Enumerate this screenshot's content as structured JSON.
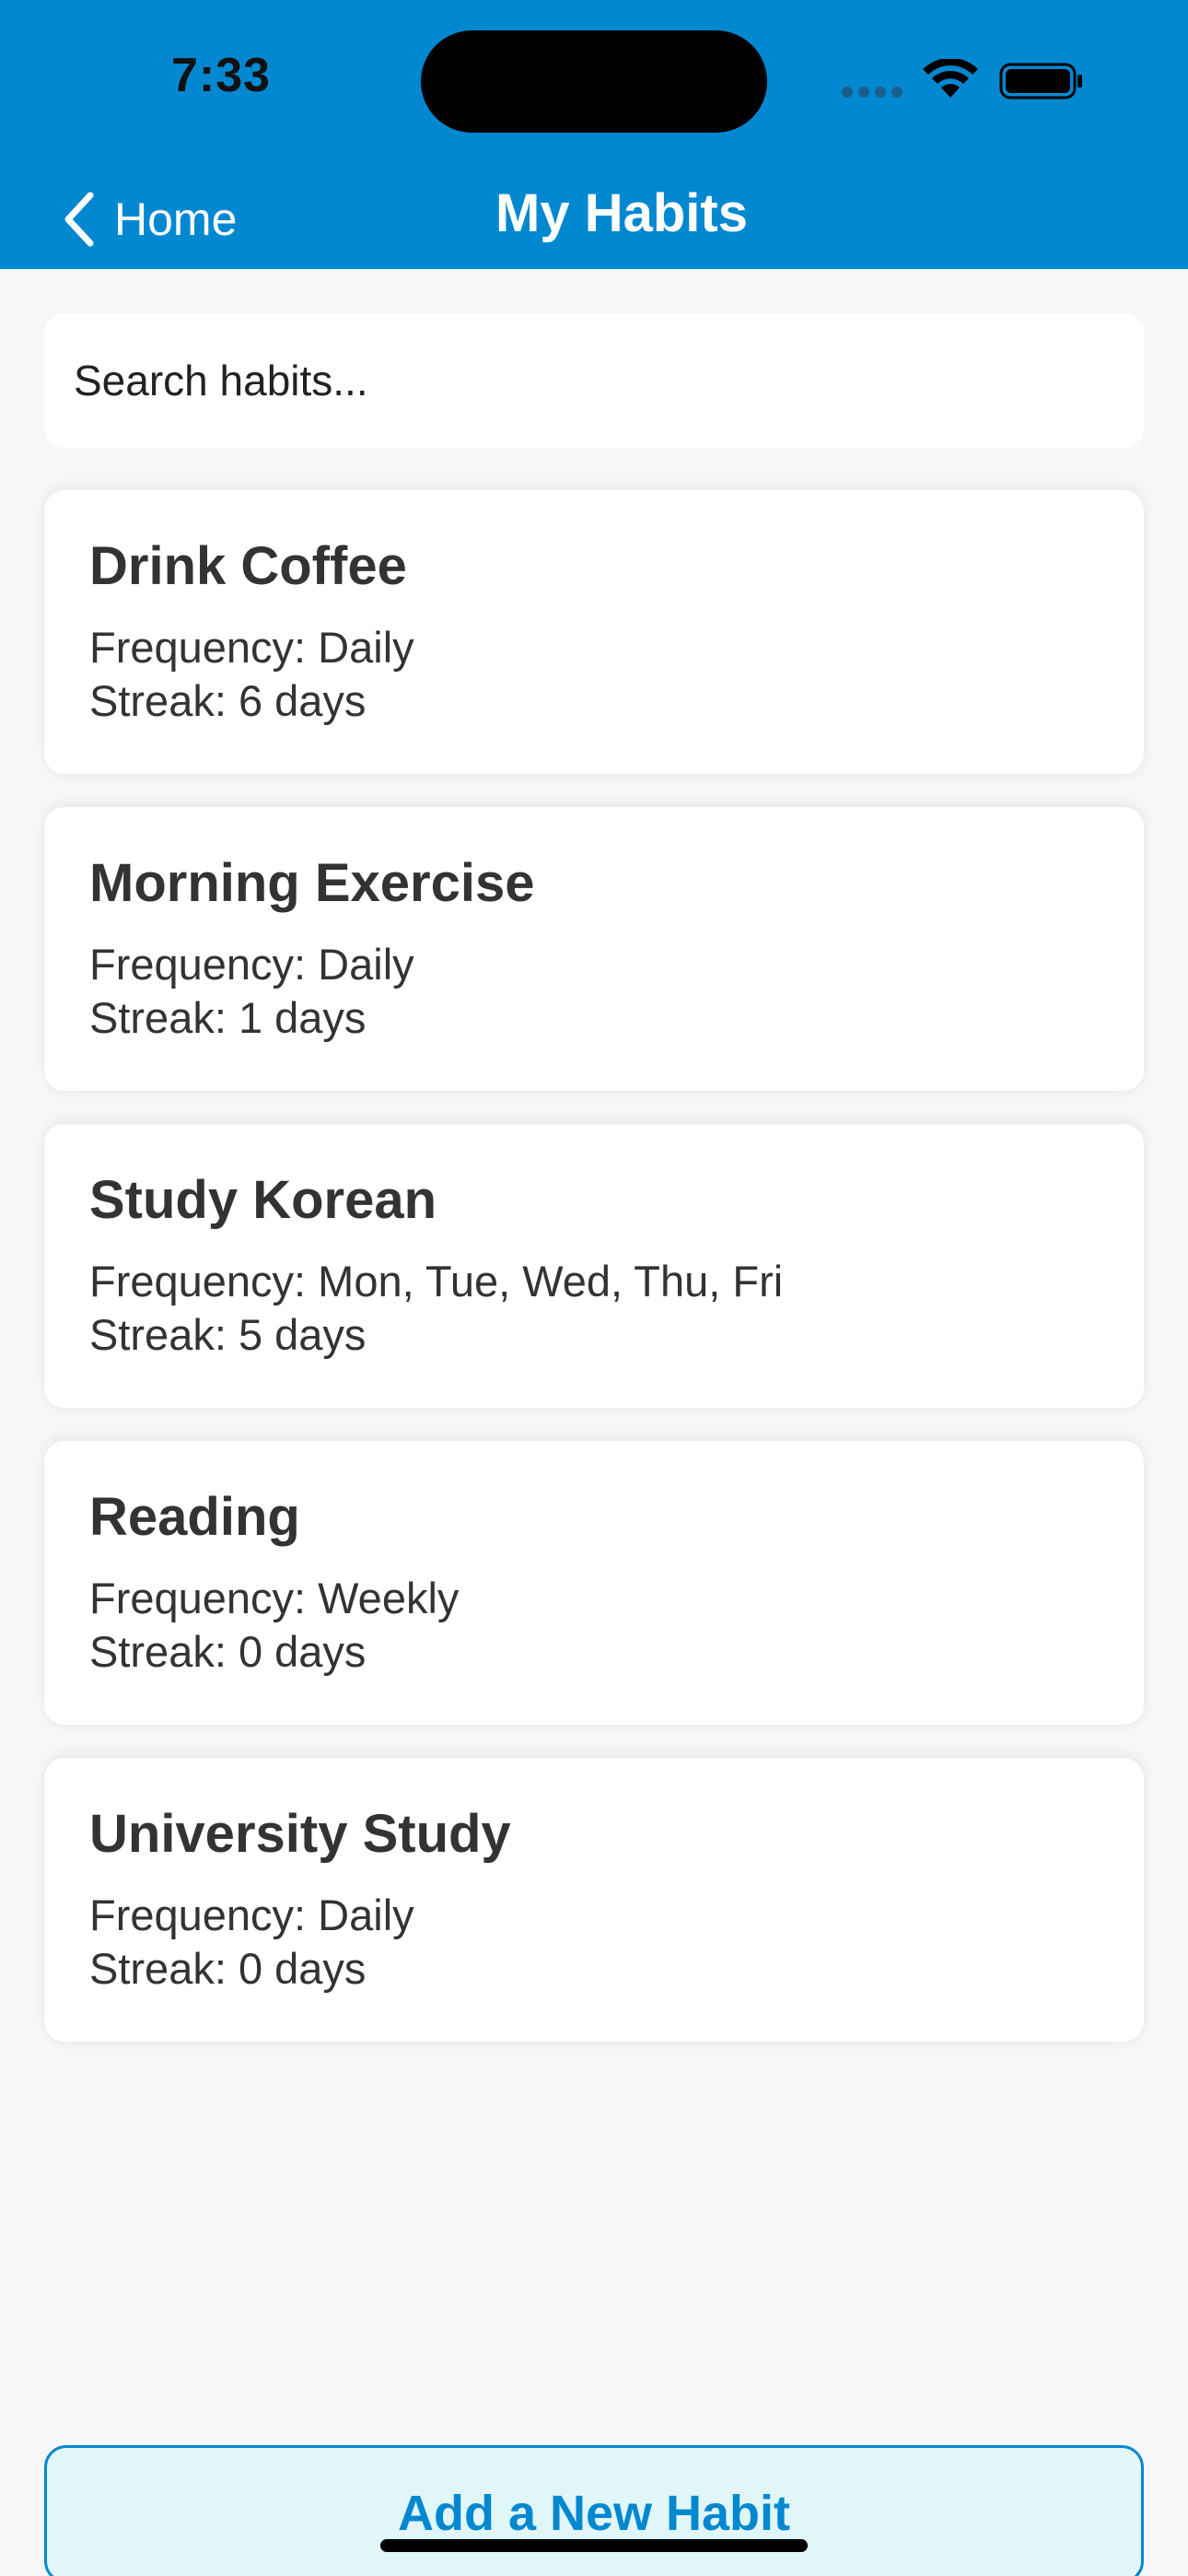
{
  "status_bar": {
    "time": "7:33",
    "icons": [
      "cellular-signal-icon",
      "wifi-icon",
      "battery-icon"
    ]
  },
  "nav": {
    "back_label": "Home",
    "title": "My Habits",
    "back_icon": "chevron-left-icon"
  },
  "search": {
    "placeholder": "Search habits...",
    "value": ""
  },
  "habits": [
    {
      "name": "Drink Coffee",
      "frequency": "Frequency: Daily",
      "streak": "Streak: 6 days"
    },
    {
      "name": "Morning Exercise",
      "frequency": "Frequency: Daily",
      "streak": "Streak: 1 days"
    },
    {
      "name": "Study Korean",
      "frequency": "Frequency: Mon, Tue, Wed, Thu, Fri",
      "streak": "Streak: 5 days"
    },
    {
      "name": "Reading",
      "frequency": "Frequency: Weekly",
      "streak": "Streak: 0 days"
    },
    {
      "name": "University Study",
      "frequency": "Frequency: Daily",
      "streak": "Streak: 0 days"
    }
  ],
  "actions": {
    "add_label": "Add a New Habit"
  },
  "colors": {
    "primary": "#0288d1",
    "background": "#f6f7f9",
    "card": "#ffffff",
    "text": "#333333",
    "add_button_bg": "#e0f6f9"
  }
}
